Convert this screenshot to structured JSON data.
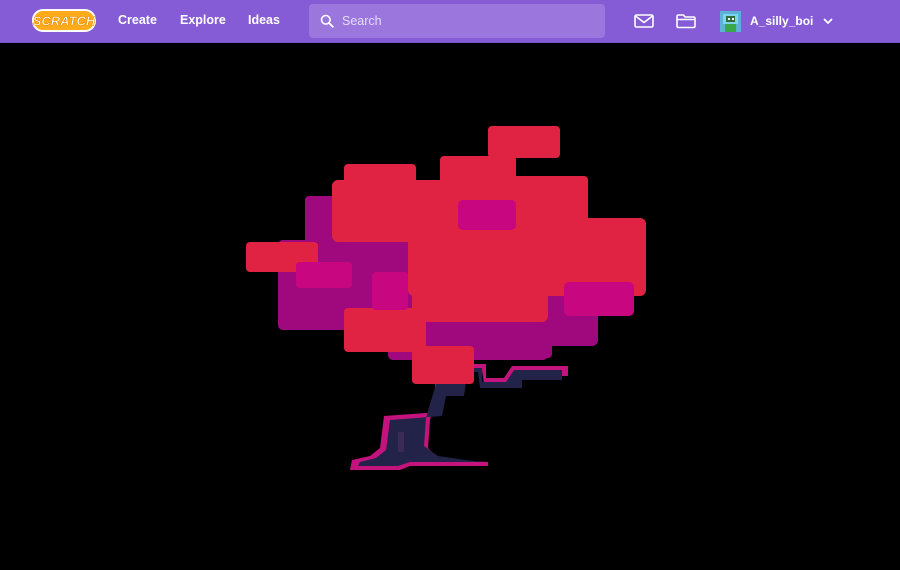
{
  "header": {
    "logo_text": "SCRATCH",
    "nav": {
      "create": "Create",
      "explore": "Explore",
      "ideas": "Ideas"
    },
    "search": {
      "placeholder": "Search",
      "value": ""
    },
    "account": {
      "username": "A_silly_boi"
    }
  },
  "icons": {
    "logo": "scratch-logo",
    "search": "search-icon",
    "messages": "envelope-icon",
    "my_stuff": "folder-icon",
    "avatar": "user-avatar",
    "account_menu": "chevron-down-icon"
  },
  "colors": {
    "header_bg": "#855cd6",
    "search_bg": "#9a76dd",
    "stage_bg": "#000000",
    "leaf_red": "#e02343",
    "leaf_magenta": "#a0087e",
    "leaf_pink": "#c7067f",
    "trunk": "#23234a",
    "trunk_outline": "#c5137e"
  },
  "stage": {
    "content": "pixel-art tree"
  }
}
